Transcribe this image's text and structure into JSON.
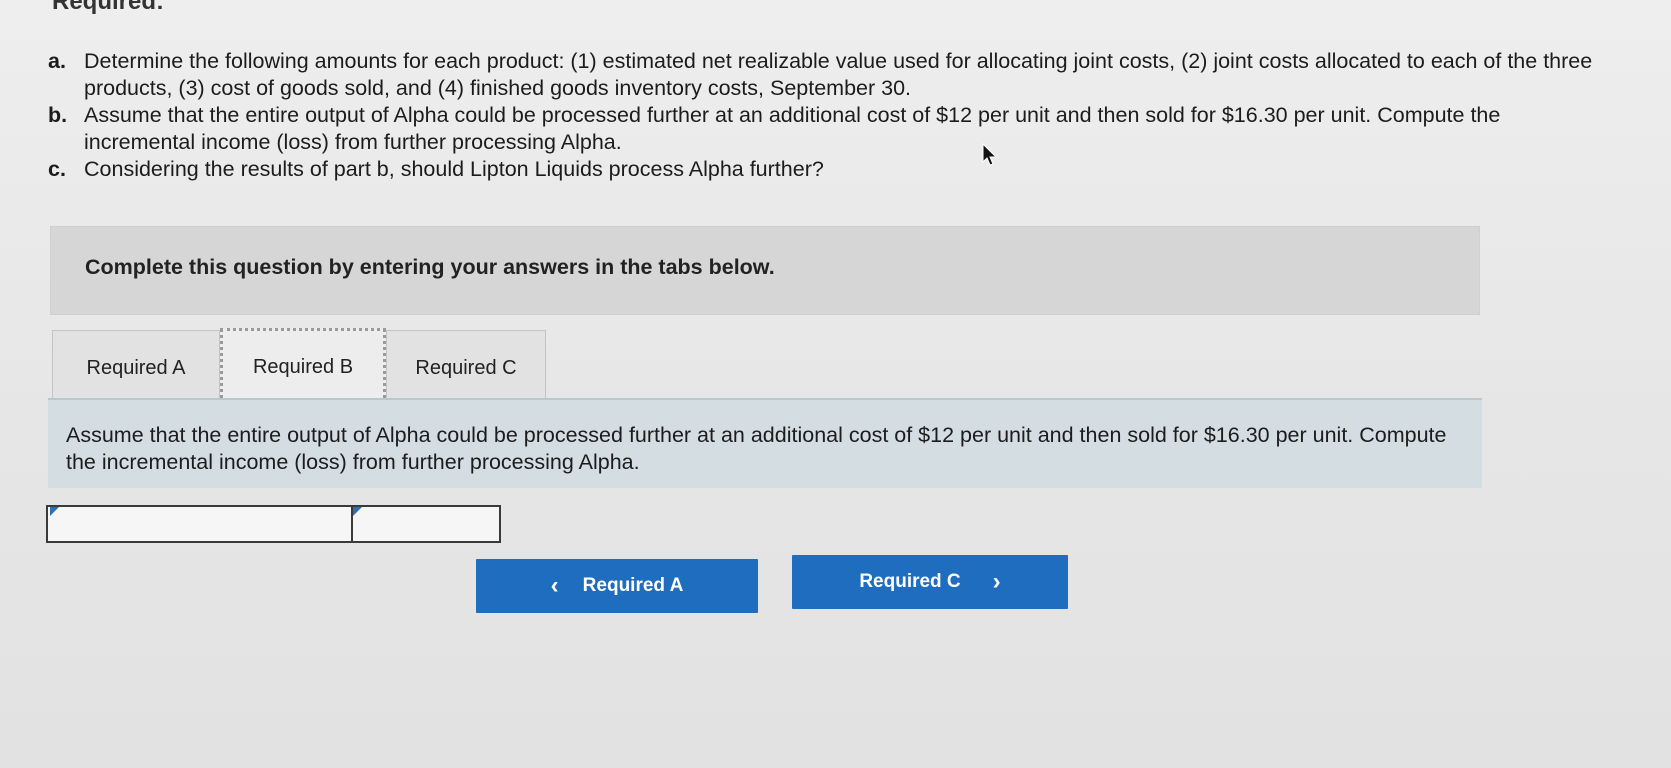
{
  "heading": "Required:",
  "requirements": [
    {
      "letter": "a.",
      "text": "Determine the following amounts for each product: (1) estimated net realizable value used for allocating joint costs, (2) joint costs allocated to each of the three products, (3) cost of goods sold, and (4) finished goods inventory costs, September 30."
    },
    {
      "letter": "b.",
      "text": "Assume that the entire output of Alpha could be processed further at an additional cost of $12 per unit and then sold for $16.30 per unit. Compute the incremental income (loss) from further processing Alpha."
    },
    {
      "letter": "c.",
      "text": "Considering the results of part b, should Lipton Liquids process Alpha further?"
    }
  ],
  "instruction": "Complete this question by entering your answers in the tabs below.",
  "tabs": [
    {
      "label": "Required A",
      "active": false
    },
    {
      "label": "Required B",
      "active": true
    },
    {
      "label": "Required C",
      "active": false
    }
  ],
  "question": "Assume that the entire output of Alpha could be processed further at an additional cost of $12 per unit and then sold for $16.30 per unit. Compute the incremental income (loss) from further processing Alpha.",
  "answer": {
    "label_value": "",
    "amount_value": ""
  },
  "nav": {
    "prev_label": "Required A",
    "next_label": "Required C",
    "prev_icon": "chevron-left-icon",
    "next_icon": "chevron-right-icon"
  },
  "colors": {
    "nav_button": "#1f6dbf",
    "question_panel": "#d3dde2",
    "instruction_box": "#d6d6d6",
    "input_marker": "#2f6fb3"
  }
}
